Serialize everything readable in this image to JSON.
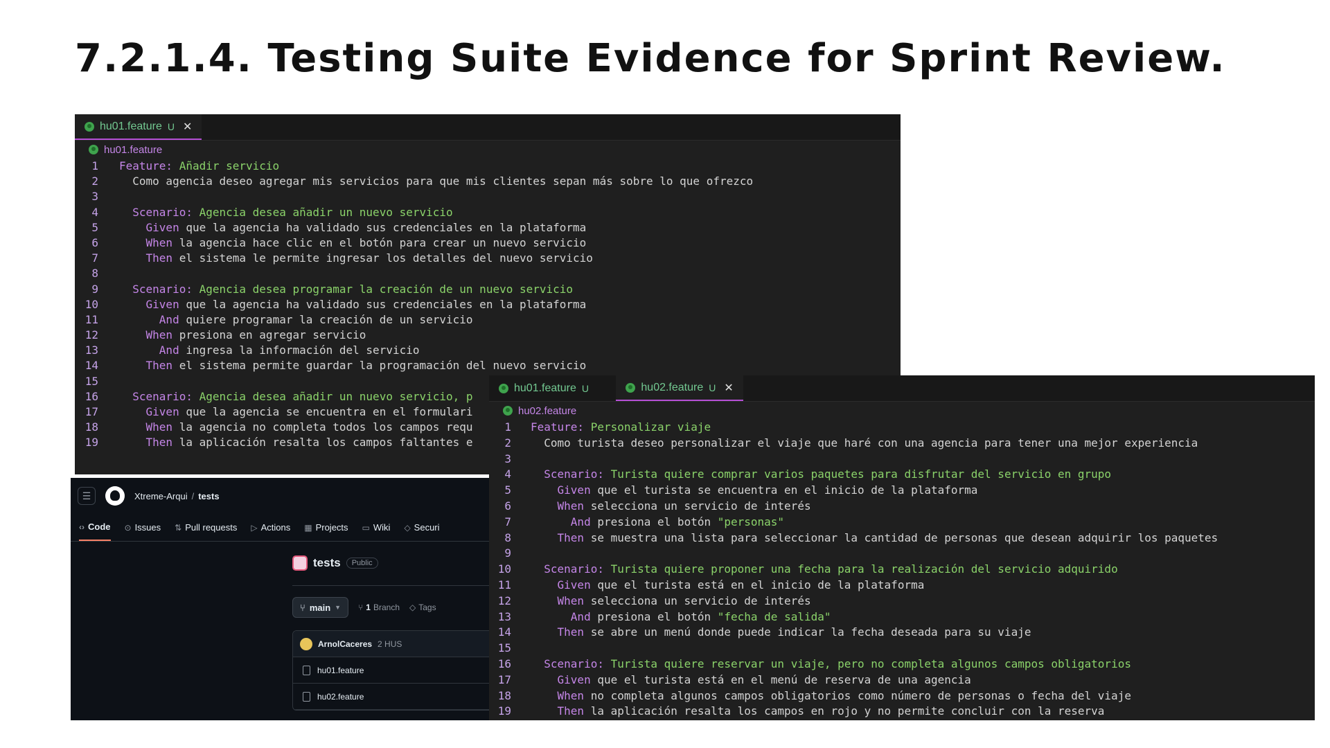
{
  "title": "7.2.1.4. Testing Suite Evidence for Sprint Review.",
  "editor1": {
    "tab": "hu01.feature",
    "tab_status": "U",
    "breadcrumb": "hu01.feature",
    "lines": [
      {
        "n": "1",
        "kw": "Feature:",
        "text": " Añadir servicio",
        "indent": "",
        "style": "title"
      },
      {
        "n": "2",
        "kw": "",
        "text": "Como agencia deseo agregar mis servicios para que mis clientes sepan más sobre lo que ofrezco",
        "indent": "  ",
        "style": "plain"
      },
      {
        "n": "3",
        "kw": "",
        "text": "",
        "indent": "",
        "style": "plain"
      },
      {
        "n": "4",
        "kw": "Scenario:",
        "text": " Agencia desea añadir un nuevo servicio",
        "indent": "  ",
        "style": "title"
      },
      {
        "n": "5",
        "kw": "Given",
        "text": " que la agencia ha validado sus credenciales en la plataforma",
        "indent": "    ",
        "style": "plain"
      },
      {
        "n": "6",
        "kw": "When",
        "text": " la agencia hace clic en el botón para crear un nuevo servicio",
        "indent": "    ",
        "style": "plain"
      },
      {
        "n": "7",
        "kw": "Then",
        "text": " el sistema le permite ingresar los detalles del nuevo servicio",
        "indent": "    ",
        "style": "plain"
      },
      {
        "n": "8",
        "kw": "",
        "text": "",
        "indent": "",
        "style": "plain"
      },
      {
        "n": "9",
        "kw": "Scenario:",
        "text": " Agencia desea programar la creación de un nuevo servicio",
        "indent": "  ",
        "style": "title"
      },
      {
        "n": "10",
        "kw": "Given",
        "text": " que la agencia ha validado sus credenciales en la plataforma",
        "indent": "    ",
        "style": "plain"
      },
      {
        "n": "11",
        "kw": "And",
        "text": " quiere programar la creación de un servicio",
        "indent": "      ",
        "style": "plain"
      },
      {
        "n": "12",
        "kw": "When",
        "text": " presiona en agregar servicio",
        "indent": "    ",
        "style": "plain"
      },
      {
        "n": "13",
        "kw": "And",
        "text": " ingresa la información del servicio",
        "indent": "      ",
        "style": "plain"
      },
      {
        "n": "14",
        "kw": "Then",
        "text": " el sistema permite guardar la programación del nuevo servicio",
        "indent": "    ",
        "style": "plain"
      },
      {
        "n": "15",
        "kw": "",
        "text": "",
        "indent": "",
        "style": "plain"
      },
      {
        "n": "16",
        "kw": "Scenario:",
        "text": " Agencia desea añadir un nuevo servicio, p",
        "indent": "  ",
        "style": "title"
      },
      {
        "n": "17",
        "kw": "Given",
        "text": " que la agencia se encuentra en el formulari",
        "indent": "    ",
        "style": "plain"
      },
      {
        "n": "18",
        "kw": "When",
        "text": " la agencia no completa todos los campos requ",
        "indent": "    ",
        "style": "plain"
      },
      {
        "n": "19",
        "kw": "Then",
        "text": " la aplicación resalta los campos faltantes e",
        "indent": "    ",
        "style": "plain"
      }
    ]
  },
  "editor2": {
    "tabs": [
      {
        "label": "hu01.feature",
        "status": "U",
        "active": false
      },
      {
        "label": "hu02.feature",
        "status": "U",
        "active": true
      }
    ],
    "breadcrumb": "hu02.feature",
    "lines": [
      {
        "n": "1",
        "kw": "Feature:",
        "text": " Personalizar viaje",
        "indent": "",
        "style": "title"
      },
      {
        "n": "2",
        "kw": "",
        "text": "Como turista deseo personalizar el viaje que haré con una agencia para tener una mejor experiencia",
        "indent": "  ",
        "style": "plain"
      },
      {
        "n": "3",
        "kw": "",
        "text": "",
        "indent": "",
        "style": "plain"
      },
      {
        "n": "4",
        "kw": "Scenario:",
        "text": " Turista quiere comprar varios paquetes para disfrutar del servicio en grupo",
        "indent": "  ",
        "style": "title"
      },
      {
        "n": "5",
        "kw": "Given",
        "text": " que el turista se encuentra en el inicio de la plataforma",
        "indent": "    ",
        "style": "plain"
      },
      {
        "n": "6",
        "kw": "When",
        "text": " selecciona un servicio de interés",
        "indent": "    ",
        "style": "plain"
      },
      {
        "n": "7",
        "kw": "And",
        "text": " presiona el botón ",
        "indent": "      ",
        "style": "plain",
        "str": "\"personas\""
      },
      {
        "n": "8",
        "kw": "Then",
        "text": " se muestra una lista para seleccionar la cantidad de personas que desean adquirir los paquetes",
        "indent": "    ",
        "style": "plain"
      },
      {
        "n": "9",
        "kw": "",
        "text": "",
        "indent": "",
        "style": "plain"
      },
      {
        "n": "10",
        "kw": "Scenario:",
        "text": " Turista quiere proponer una fecha para la realización del servicio adquirido",
        "indent": "  ",
        "style": "title"
      },
      {
        "n": "11",
        "kw": "Given",
        "text": " que el turista está en el inicio de la plataforma",
        "indent": "    ",
        "style": "plain"
      },
      {
        "n": "12",
        "kw": "When",
        "text": " selecciona un servicio de interés",
        "indent": "    ",
        "style": "plain"
      },
      {
        "n": "13",
        "kw": "And",
        "text": " presiona el botón ",
        "indent": "      ",
        "style": "plain",
        "str": "\"fecha de salida\""
      },
      {
        "n": "14",
        "kw": "Then",
        "text": " se abre un menú donde puede indicar la fecha deseada para su viaje",
        "indent": "    ",
        "style": "plain"
      },
      {
        "n": "15",
        "kw": "",
        "text": "",
        "indent": "",
        "style": "plain"
      },
      {
        "n": "16",
        "kw": "Scenario:",
        "text": " Turista quiere reservar un viaje, pero no completa algunos campos obligatorios",
        "indent": "  ",
        "style": "title"
      },
      {
        "n": "17",
        "kw": "Given",
        "text": " que el turista está en el menú de reserva de una agencia",
        "indent": "    ",
        "style": "plain"
      },
      {
        "n": "18",
        "kw": "When",
        "text": " no completa algunos campos obligatorios como número de personas o fecha del viaje",
        "indent": "    ",
        "style": "plain"
      },
      {
        "n": "19",
        "kw": "Then",
        "text": " la aplicación resalta los campos en rojo y no permite concluir con la reserva",
        "indent": "    ",
        "style": "plain"
      }
    ]
  },
  "github": {
    "owner": "Xtreme-Arqui",
    "separator": "/",
    "repo": "tests",
    "nav": [
      "Code",
      "Issues",
      "Pull requests",
      "Actions",
      "Projects",
      "Wiki",
      "Securi"
    ],
    "nav_icons": [
      "‹›",
      "⊙",
      "⇅",
      "▷",
      "▦",
      "▭",
      "◇"
    ],
    "repo_title": "tests",
    "visibility": "Public",
    "branch": "main",
    "branch_count": "1",
    "branch_word": "Branch",
    "tags_label": "Tags",
    "commit_author": "ArnolCaceres",
    "commit_message": "2 HUS",
    "files": [
      "hu01.feature",
      "hu02.feature"
    ]
  }
}
